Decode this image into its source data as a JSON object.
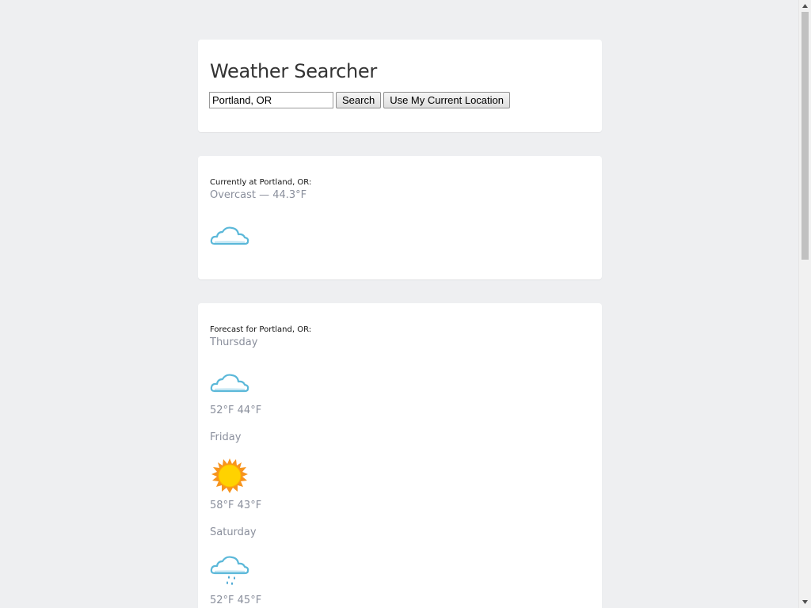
{
  "app": {
    "title": "Weather Searcher"
  },
  "search": {
    "value": "Portland, OR",
    "search_label": "Search",
    "location_label": "Use My Current Location"
  },
  "current": {
    "caption": "Currently at Portland, OR:",
    "summary": "Overcast — 44.3°F",
    "icon": "cloud-icon"
  },
  "forecast": {
    "caption": "Forecast for Portland, OR:",
    "days": [
      {
        "name": "Thursday",
        "temps": "52°F 44°F",
        "icon": "cloud-icon"
      },
      {
        "name": "Friday",
        "temps": "58°F 43°F",
        "icon": "sun-icon"
      },
      {
        "name": "Saturday",
        "temps": "52°F 45°F",
        "icon": "rain-cloud-icon"
      }
    ]
  },
  "colors": {
    "background": "#eeeff1",
    "card": "#ffffff",
    "muted_text": "#8a8f9c",
    "cloud_stroke": "#5bb8d9",
    "sun_ray": "#f7941d",
    "sun_core": "#ffd200",
    "rain": "#3aa0cf"
  }
}
